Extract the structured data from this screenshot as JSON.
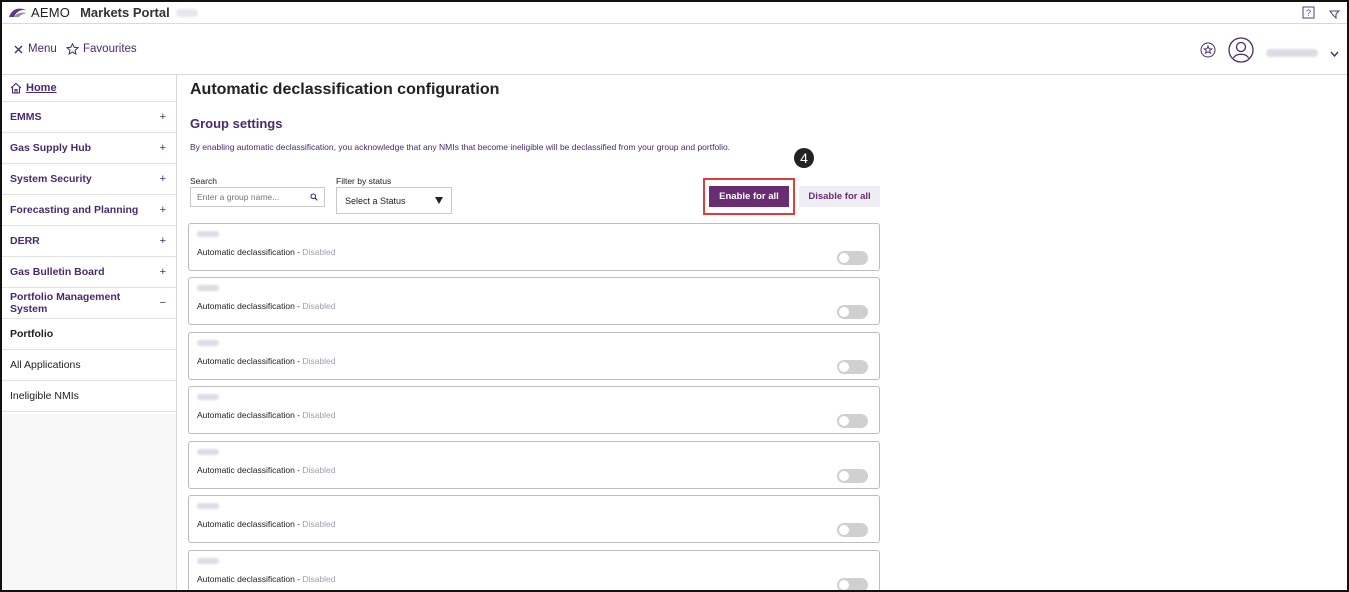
{
  "header": {
    "brand": "AEMO",
    "portal": "Markets Portal"
  },
  "menubar": {
    "menu_label": "Menu",
    "favourites_label": "Favourites"
  },
  "sidebar": {
    "home": "Home",
    "items": [
      {
        "label": "EMMS",
        "sign": "+"
      },
      {
        "label": "Gas Supply Hub",
        "sign": "+"
      },
      {
        "label": "System Security",
        "sign": "+"
      },
      {
        "label": "Forecasting and Planning",
        "sign": "+"
      },
      {
        "label": "DERR",
        "sign": "+"
      },
      {
        "label": "Gas Bulletin Board",
        "sign": "+"
      },
      {
        "label": "Portfolio Management System",
        "sign": "−"
      }
    ],
    "subitems": [
      {
        "label": "Portfolio",
        "active": true
      },
      {
        "label": "All Applications",
        "active": false
      },
      {
        "label": "Ineligible NMIs",
        "active": false
      }
    ]
  },
  "main": {
    "title": "Automatic declassification configuration",
    "section_title": "Group settings",
    "note": "By enabling automatic declassification, you acknowledge that any NMIs that become ineligible will be declassified from your group and portfolio.",
    "search_label": "Search",
    "search_placeholder": "Enter a group name...",
    "filter_label": "Filter by status",
    "filter_value": "Select a Status",
    "enable_all": "Enable for all",
    "disable_all": "Disable for all",
    "step_badge": "4",
    "groups": [
      {
        "label": "Automatic declassification - ",
        "status": "Disabled"
      },
      {
        "label": "Automatic declassification - ",
        "status": "Disabled"
      },
      {
        "label": "Automatic declassification - ",
        "status": "Disabled"
      },
      {
        "label": "Automatic declassification - ",
        "status": "Disabled"
      },
      {
        "label": "Automatic declassification - ",
        "status": "Disabled"
      },
      {
        "label": "Automatic declassification - ",
        "status": "Disabled"
      },
      {
        "label": "Automatic declassification - ",
        "status": "Disabled"
      }
    ]
  },
  "colors": {
    "brand_purple": "#6a2c73",
    "text_purple": "#4a2a6b",
    "highlight_red": "#e23b3b"
  }
}
